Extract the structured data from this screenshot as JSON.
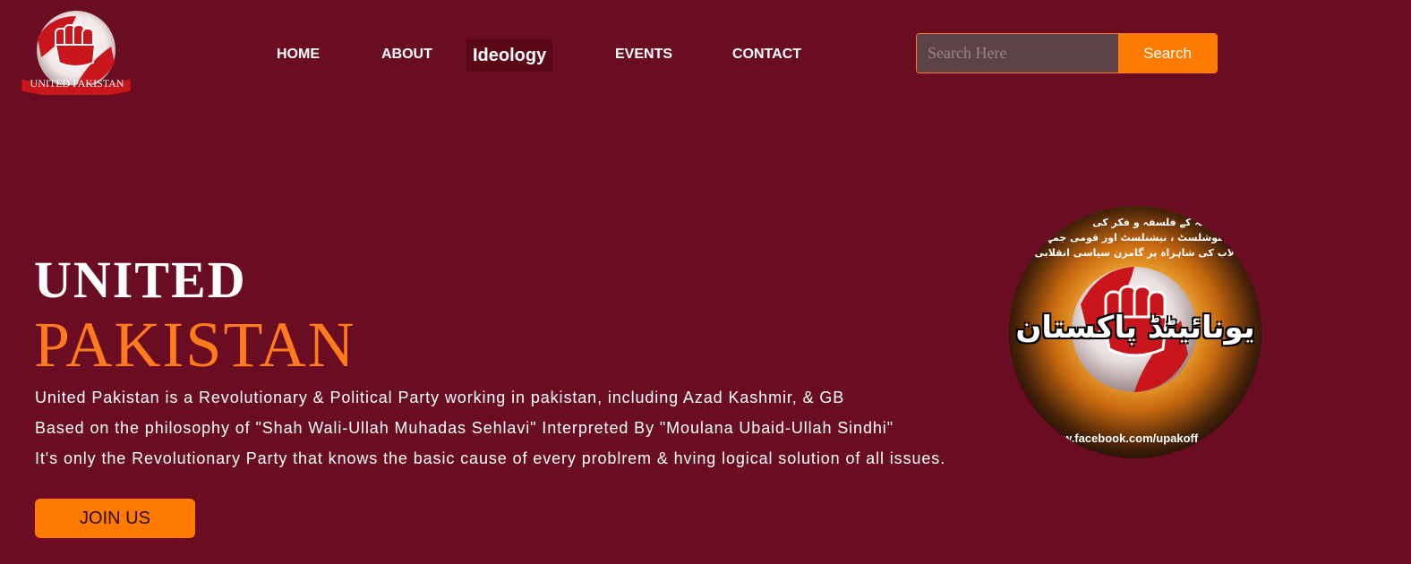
{
  "logo": {
    "icon": "raised-fist-icon",
    "text": "UNITED PAKISTAN"
  },
  "nav": {
    "items": [
      {
        "label": "HOME"
      },
      {
        "label": "ABOUT"
      },
      {
        "label": "Ideology"
      },
      {
        "label": "EVENTS"
      },
      {
        "label": "CONTACT"
      }
    ],
    "active": "Ideology"
  },
  "search": {
    "placeholder": "Search Here",
    "button_label": "Search"
  },
  "hero": {
    "title_line1": "UNITED",
    "title_line2": "PAKISTAN",
    "lines": [
      "United Pakistan is a Revolutionary & Political Party working in pakistan, including Azad Kashmir, & GB",
      "Based on the philosophy of \"Shah Wali-Ullah Muhadas Sehlavi\" Interpreted By \"Moulana Ubaid-Ullah Sindhi\"",
      "It's only the Revolutionary Party that knows the basic cause of every problrem & hving logical solution of all issues."
    ],
    "join_label": "JOIN US"
  },
  "badge": {
    "icon": "raised-fist-icon",
    "urdu_title": "یونائیٹڈ پاکستان",
    "top_lines": [
      "ولی اللہ کے فلسفہ و فکر کی",
      "، سوشلسٹ ، نیشنلسٹ اور قومی جمہو",
      "لاب کی شاہراہ پر گامزن سیاسی انقلابی پارٹی ."
    ],
    "url": "w.facebook.com/upakoff"
  },
  "colors": {
    "background": "#6b0d22",
    "accent": "#ff7b00",
    "title_orange": "#ff7b1d",
    "active_nav_bg": "#5a0716",
    "search_field_bg": "#5d4347"
  }
}
